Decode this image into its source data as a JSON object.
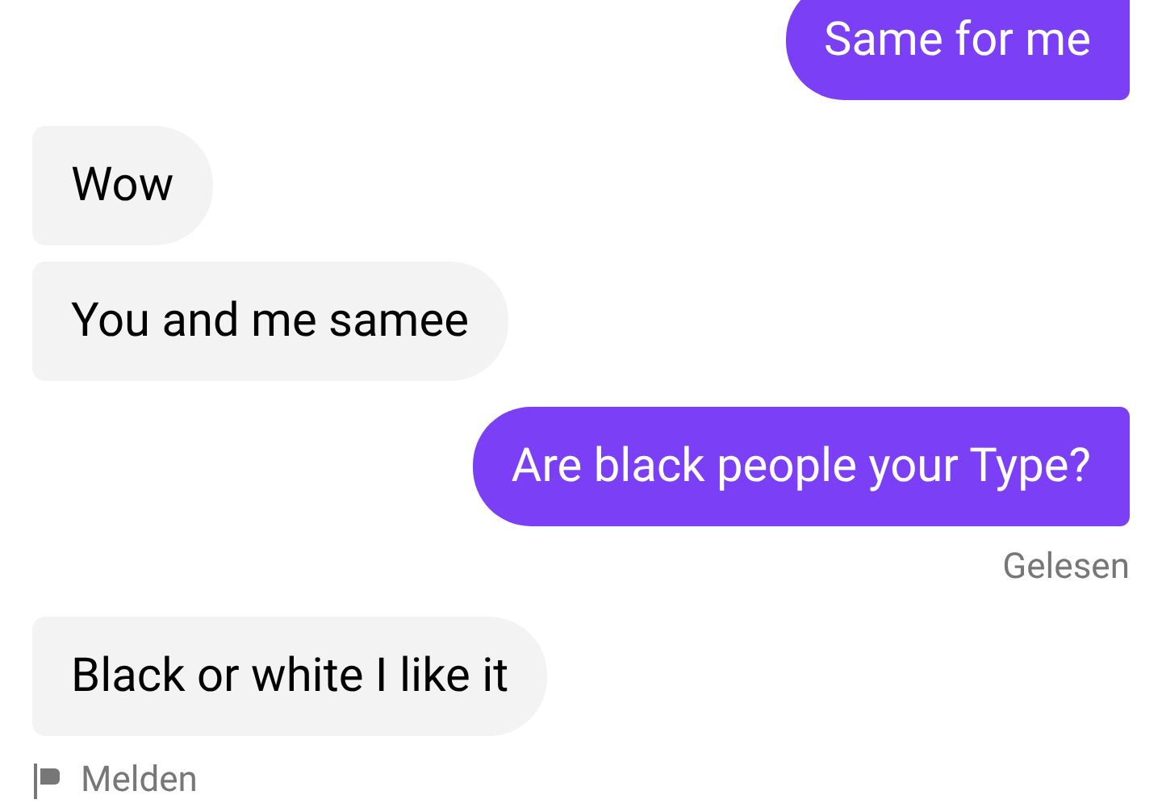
{
  "messages": [
    {
      "kind": "sent",
      "text": "Same for me"
    },
    {
      "kind": "received",
      "text": "Wow"
    },
    {
      "kind": "received",
      "text": "You and me samee"
    },
    {
      "kind": "sent",
      "text": "Are black people your Type?",
      "receipt": "Gelesen"
    },
    {
      "kind": "received",
      "text": "Black or white I like it"
    }
  ],
  "report_link": "Melden"
}
